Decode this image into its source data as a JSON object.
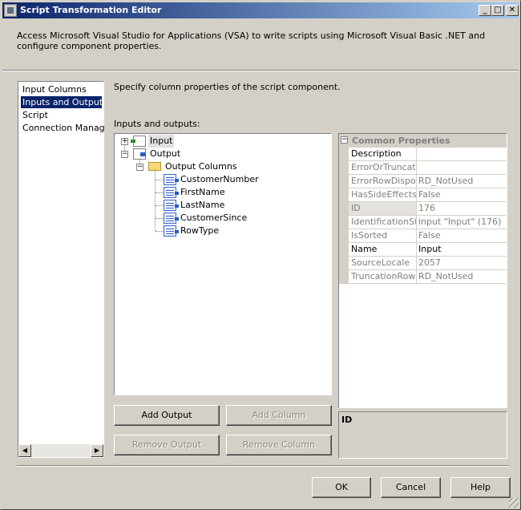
{
  "window": {
    "title": "Script Transformation Editor",
    "controls": {
      "minimize": "_",
      "maximize": "□",
      "close": "✕"
    }
  },
  "description": "Access Microsoft Visual Studio for Applications (VSA) to write scripts using Microsoft Visual Basic .NET and configure component properties.",
  "nav": {
    "items": [
      {
        "label": "Input Columns",
        "selected": false
      },
      {
        "label": "Inputs and Outputs",
        "selected": true
      },
      {
        "label": "Script",
        "selected": false
      },
      {
        "label": "Connection Managers",
        "selected": false
      }
    ],
    "scroll_left": "◀",
    "scroll_right": "▶"
  },
  "main": {
    "instruction": "Specify column properties of the script component.",
    "io_label": "Inputs and outputs:",
    "tree": {
      "input": "Input",
      "output": "Output",
      "output_columns": "Output Columns",
      "columns": [
        "CustomerNumber",
        "FirstName",
        "LastName",
        "CustomerSince",
        "RowType"
      ],
      "expand_collapsed": "+",
      "expand_open": "−"
    },
    "buttons": {
      "add_output": "Add Output",
      "add_column": "Add Column",
      "remove_output": "Remove Output",
      "remove_column": "Remove Column"
    }
  },
  "properties": {
    "category": "Common Properties",
    "collapse": "−",
    "rows": [
      {
        "name": "Description",
        "value": "",
        "readonly": false
      },
      {
        "name": "ErrorOrTruncatic",
        "value": "",
        "readonly": true
      },
      {
        "name": "ErrorRowDisposi",
        "value": "RD_NotUsed",
        "readonly": true
      },
      {
        "name": "HasSideEffects",
        "value": "False",
        "readonly": true
      },
      {
        "name": "ID",
        "value": "176",
        "readonly": true
      },
      {
        "name": "IdentificationStri",
        "value": "input \"Input\" (176)",
        "readonly": true
      },
      {
        "name": "IsSorted",
        "value": "False",
        "readonly": true
      },
      {
        "name": "Name",
        "value": "Input",
        "readonly": false
      },
      {
        "name": "SourceLocale",
        "value": "2057",
        "readonly": true
      },
      {
        "name": "TruncationRowD",
        "value": "RD_NotUsed",
        "readonly": true
      }
    ],
    "help_title": "ID"
  },
  "footer": {
    "ok": "OK",
    "cancel": "Cancel",
    "help": "Help"
  }
}
